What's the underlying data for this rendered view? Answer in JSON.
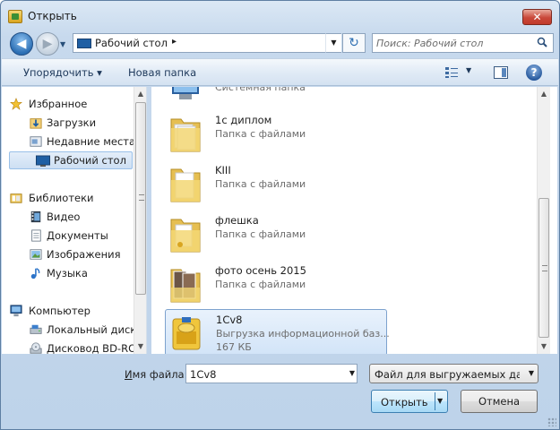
{
  "window": {
    "title": "Открыть",
    "close_glyph": "✕"
  },
  "nav": {
    "back_glyph": "◀",
    "forward_glyph": "▶",
    "address_path": "Рабочий стол",
    "address_sep": "▸",
    "refresh_glyph": "↻",
    "search_placeholder": "Поиск: Рабочий стол"
  },
  "toolbar": {
    "organize_label": "Упорядочить ▾",
    "new_folder_label": "Новая папка",
    "help_glyph": "?"
  },
  "sidebar": {
    "favorites_label": "Избранное",
    "downloads_label": "Загрузки",
    "recent_label": "Недавние места",
    "desktop_label": "Рабочий стол",
    "libraries_label": "Библиотеки",
    "video_label": "Видео",
    "documents_label": "Документы",
    "images_label": "Изображения",
    "music_label": "Музыка",
    "computer_label": "Компьютер",
    "local_disk_label": "Локальный диск",
    "bd_drive_label": "Дисковод BD-RO"
  },
  "files": {
    "top_partial_type": "Системная папка",
    "item1": {
      "name": "1с диплом",
      "type": "Папка с файлами"
    },
    "item2": {
      "name": "KIII",
      "type": "Папка с файлами"
    },
    "item3": {
      "name": "флешка",
      "type": "Папка с файлами"
    },
    "item4": {
      "name": "фото осень 2015",
      "type": "Папка с файлами"
    },
    "item5": {
      "name": "1Cv8",
      "type": "Выгрузка информационной баз...",
      "size": "167 КБ"
    }
  },
  "bottom": {
    "filename_label_pre": "И",
    "filename_label_post": "мя файла:",
    "filename_value": "1Cv8",
    "filetype_value": "Файл для выгружаемых данных",
    "open_label": "Открыть",
    "cancel_label": "Отмена"
  },
  "colors": {
    "accent": "#3c7fb1",
    "selection_border": "#7da2ce",
    "folder_yellow": "#f3d774"
  }
}
